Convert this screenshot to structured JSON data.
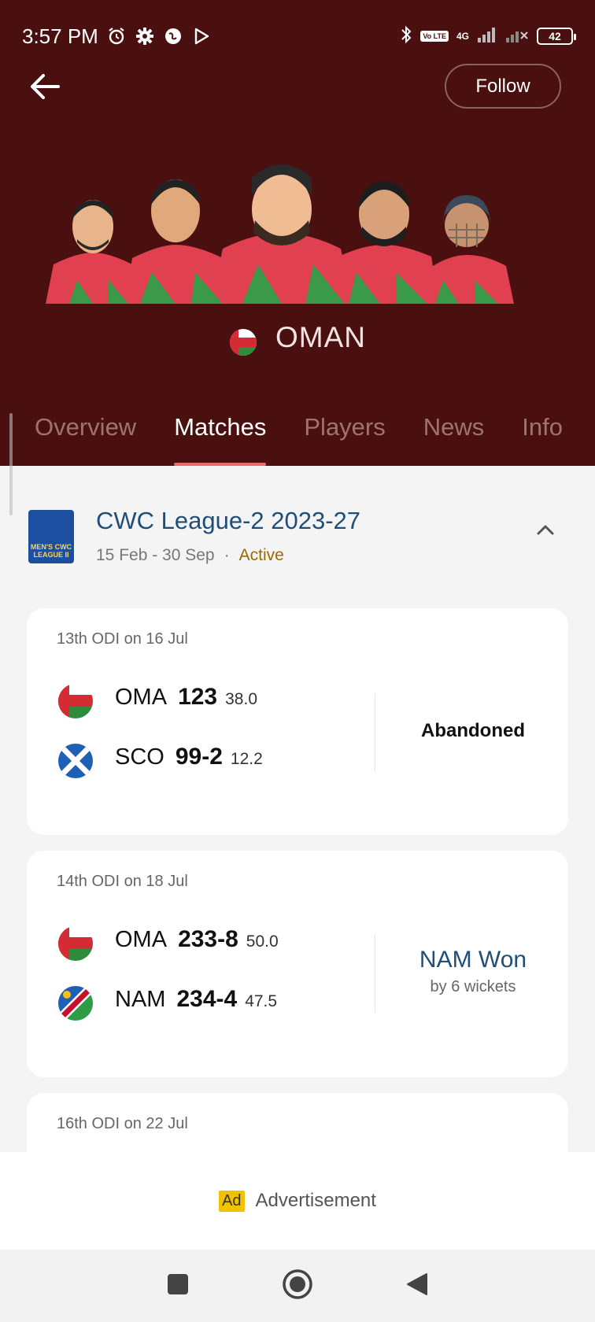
{
  "status_bar": {
    "time": "3:57 PM",
    "icons": [
      "alarm-icon",
      "gear-icon",
      "browser-icon",
      "play-icon"
    ],
    "right_icons": [
      "bluetooth-icon",
      "volte-icon",
      "signal-icon",
      "signal-icon"
    ],
    "volte": "Vo LTE",
    "network": "4G",
    "battery": "42"
  },
  "header": {
    "follow_label": "Follow",
    "team_name": "OMAN",
    "accent_color": "#4a1010"
  },
  "tabs": [
    {
      "label": "Overview"
    },
    {
      "label": "Matches"
    },
    {
      "label": "Players"
    },
    {
      "label": "News"
    },
    {
      "label": "Info"
    }
  ],
  "series": {
    "logo_text": "MEN'S CWC LEAGUE II",
    "title": "CWC League-2 2023-27",
    "dates": "15 Feb - 30 Sep",
    "dot": "·",
    "status": "Active"
  },
  "matches": [
    {
      "meta": "13th ODI on 16 Jul",
      "team1": {
        "abbr": "OMA",
        "score": "123",
        "overs": "38.0"
      },
      "team2": {
        "abbr": "SCO",
        "score": "99-2",
        "overs": "12.2"
      },
      "result": "Abandoned"
    },
    {
      "meta": "14th ODI on 18 Jul",
      "team1": {
        "abbr": "OMA",
        "score": "233-8",
        "overs": "50.0"
      },
      "team2": {
        "abbr": "NAM",
        "score": "234-4",
        "overs": "47.5"
      },
      "result": "NAM Won",
      "result_detail": "by 6 wickets"
    },
    {
      "meta": "16th ODI on 22 Jul"
    }
  ],
  "ad": {
    "badge": "Ad",
    "text": "Advertisement"
  }
}
